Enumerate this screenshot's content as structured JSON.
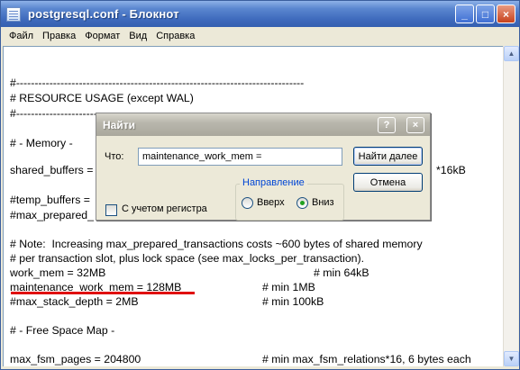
{
  "window": {
    "title": "postgresql.conf - Блокнот",
    "controls": {
      "minimize": "_",
      "maximize": "□",
      "close": "×"
    }
  },
  "menu": [
    {
      "label": "Файл"
    },
    {
      "label": "Правка"
    },
    {
      "label": "Формат"
    },
    {
      "label": "Вид"
    },
    {
      "label": "Справка"
    }
  ],
  "editor": {
    "lines": [
      "#------------------------------------------------------------------------------",
      "# RESOURCE USAGE (except WAL)",
      "#------------------------------------------------------------------------------",
      "",
      "# - Memory -",
      "",
      "shared_buffers =",
      "",
      "#temp_buffers =",
      "#max_prepared_",
      "",
      "# Note:  Increasing max_prepared_transactions costs ~600 bytes of shared memory",
      "# per transaction slot, plus lock space (see max_locks_per_transaction).",
      "work_mem = 32MB",
      "maintenance_work_mem = 128MB",
      "#max_stack_depth = 2MB",
      "",
      "# - Free Space Map -",
      "",
      "max_fsm_pages = 204800"
    ],
    "comments": {
      "shared_buffers": "*16kB",
      "work_mem": "# min 64kB",
      "maintenance_work_mem": "# min 1MB",
      "max_stack_depth": "# min 100kB",
      "max_fsm_pages": "# min max_fsm_relations*16, 6 bytes each"
    },
    "highlight_color": "#e01010"
  },
  "find_dialog": {
    "title": "Найти",
    "help_button": "?",
    "close_button": "×",
    "what_label": "Что:",
    "search_value": "maintenance_work_mem =",
    "find_next": "Найти далее",
    "cancel": "Отмена",
    "match_case_label": "С учетом регистра",
    "match_case_checked": false,
    "direction_legend": "Направление",
    "direction_up": "Вверх",
    "direction_down": "Вниз",
    "direction_selected": "down"
  }
}
